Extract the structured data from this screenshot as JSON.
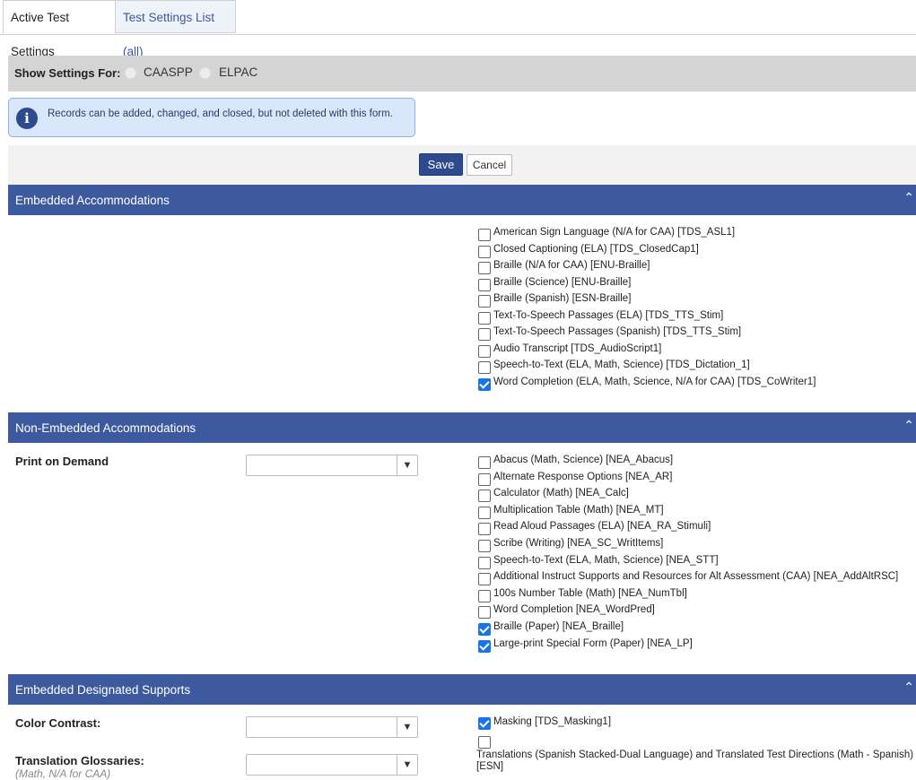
{
  "tabs": {
    "active": "Active Test Settings",
    "inactive": "Test Settings List (all)"
  },
  "show_settings": {
    "label": "Show Settings For:",
    "options": [
      "CAASPP",
      "ELPAC"
    ]
  },
  "info": {
    "icon": "info-icon",
    "text": "Records can be added, changed, and closed, but not deleted with this form."
  },
  "buttons": {
    "save": "Save",
    "cancel": "Cancel"
  },
  "sections": {
    "embedded_accommodations": {
      "title": "Embedded Accommodations",
      "items": [
        {
          "label": "American Sign Language (N/A for CAA) [TDS_ASL1]",
          "checked": false
        },
        {
          "label": "Closed Captioning (ELA) [TDS_ClosedCap1]",
          "checked": false
        },
        {
          "label": "Braille (N/A for CAA) [ENU-Braille]",
          "checked": false
        },
        {
          "label": "Braille (Science) [ENU-Braille]",
          "checked": false
        },
        {
          "label": "Braille (Spanish) [ESN-Braille]",
          "checked": false
        },
        {
          "label": "Text-To-Speech Passages (ELA) [TDS_TTS_Stim]",
          "checked": false
        },
        {
          "label": "Text-To-Speech Passages (Spanish) [TDS_TTS_Stim]",
          "checked": false
        },
        {
          "label": "Audio Transcript [TDS_AudioScript1]",
          "checked": false
        },
        {
          "label": "Speech-to-Text (ELA, Math, Science) [TDS_Dictation_1]",
          "checked": false
        },
        {
          "label": "Word Completion (ELA, Math, Science, N/A for CAA) [TDS_CoWriter1]",
          "checked": true
        }
      ]
    },
    "non_embedded_accommodations": {
      "title": "Non-Embedded Accommodations",
      "field_label": "Print on Demand",
      "select_value": "",
      "items": [
        {
          "label": "Abacus (Math, Science) [NEA_Abacus]",
          "checked": false
        },
        {
          "label": "Alternate Response Options [NEA_AR]",
          "checked": false
        },
        {
          "label": "Calculator (Math) [NEA_Calc]",
          "checked": false
        },
        {
          "label": "Multiplication Table (Math) [NEA_MT]",
          "checked": false
        },
        {
          "label": "Read Aloud Passages (ELA) [NEA_RA_Stimuli]",
          "checked": false
        },
        {
          "label": "Scribe (Writing) [NEA_SC_WritItems]",
          "checked": false
        },
        {
          "label": "Speech-to-Text (ELA, Math, Science) [NEA_STT]",
          "checked": false
        },
        {
          "label": "Additional Instruct Supports and Resources for Alt Assessment (CAA) [NEA_AddAltRSC]",
          "checked": false
        },
        {
          "label": "100s Number Table (Math) [NEA_NumTbl]",
          "checked": false
        },
        {
          "label": "Word Completion [NEA_WordPred]",
          "checked": false
        },
        {
          "label": "Braille (Paper) [NEA_Braille]",
          "checked": true
        },
        {
          "label": "Large-print Special Form (Paper) [NEA_LP]",
          "checked": true
        }
      ]
    },
    "embedded_designated_supports": {
      "title": "Embedded Designated Supports",
      "field1_label": "Color Contrast:",
      "field2_label": "Translation Glossaries:",
      "field2_note": "(Math, N/A for CAA)",
      "items": [
        {
          "label": "Masking [TDS_Masking1]",
          "checked": true
        },
        {
          "label": "Translations (Spanish Stacked-Dual Language) and Translated Test Directions (Math - Spanish) [ESN]",
          "checked": false
        }
      ]
    }
  },
  "colors": {
    "section_header": "#3e5a9e",
    "save_button": "#2e4a8f",
    "checkbox_checked": "#1a73e8",
    "info_bg": "#d9e7fb"
  }
}
